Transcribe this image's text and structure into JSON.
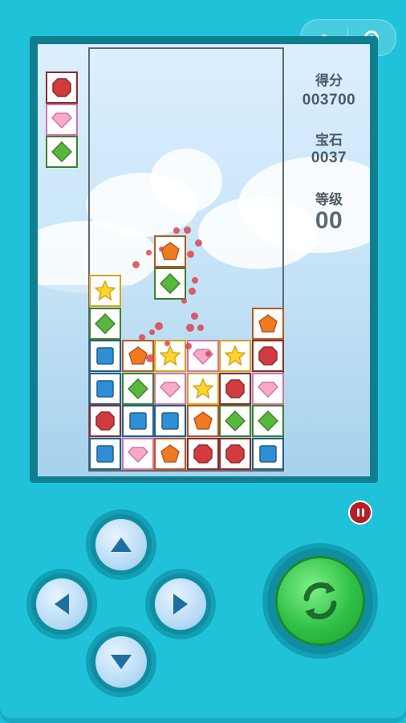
{
  "header": {
    "more_icon": "more-dots-icon",
    "close_icon": "target-circle-icon"
  },
  "stats": {
    "score_label": "得分",
    "score_value": "003700",
    "gems_label": "宝石",
    "gems_value": "0037",
    "level_label": "等级",
    "level_value": "00"
  },
  "gem_types": {
    "R": {
      "name": "red-octagon",
      "fill": "#d23a3f",
      "border": "#8c2a2d",
      "bg": "#ffffff"
    },
    "P": {
      "name": "pink-diamond",
      "fill": "#f7a9c9",
      "border": "#d274a2",
      "bg": "#ffffff"
    },
    "G": {
      "name": "green-rhombus",
      "fill": "#57b83c",
      "border": "#3f7e31",
      "bg": "#ffffff"
    },
    "Y": {
      "name": "yellow-star",
      "fill": "#ffd52a",
      "border": "#d6a21b",
      "bg": "#ffffff"
    },
    "O": {
      "name": "orange-pentagon",
      "fill": "#f07a22",
      "border": "#b8561f",
      "bg": "#ffffff"
    },
    "B": {
      "name": "blue-square",
      "fill": "#2e8fd6",
      "border": "#245f88",
      "bg": "#ffffff"
    }
  },
  "next_piece": [
    "R",
    "P",
    "G"
  ],
  "falling_piece": [
    "O",
    "G"
  ],
  "board": [
    [
      "Y",
      "",
      "",
      "",
      "",
      ""
    ],
    [
      "G",
      "",
      "",
      "",
      "",
      "O"
    ],
    [
      "B",
      "O",
      "Y",
      "P",
      "Y",
      "R"
    ],
    [
      "B",
      "G",
      "P",
      "Y",
      "R",
      "P"
    ],
    [
      "R",
      "B",
      "B",
      "O",
      "G",
      "G"
    ],
    [
      "B",
      "P",
      "O",
      "R",
      "R",
      "B"
    ]
  ],
  "controls": {
    "up": "arrow-up-icon",
    "down": "arrow-down-icon",
    "left": "arrow-left-icon",
    "right": "arrow-right-icon",
    "rotate": "rotate-icon",
    "pause": "pause-icon"
  }
}
